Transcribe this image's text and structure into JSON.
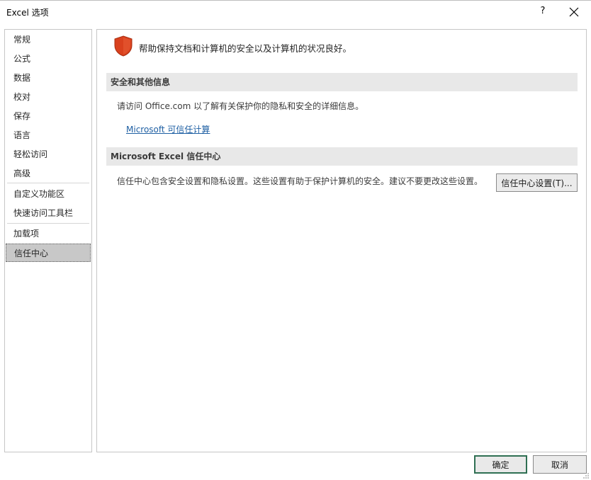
{
  "window": {
    "title": "Excel 选项",
    "help_label": "?"
  },
  "sidebar": {
    "items": [
      {
        "label": "常规"
      },
      {
        "label": "公式"
      },
      {
        "label": "数据"
      },
      {
        "label": "校对"
      },
      {
        "label": "保存"
      },
      {
        "label": "语言"
      },
      {
        "label": "轻松访问"
      },
      {
        "label": "高级"
      },
      {
        "label": "自定义功能区"
      },
      {
        "label": "快速访问工具栏"
      },
      {
        "label": "加载项"
      },
      {
        "label": "信任中心"
      }
    ],
    "selected": "信任中心"
  },
  "main": {
    "header": "帮助保持文档和计算机的安全以及计算机的状况良好。",
    "section_security": {
      "title": "安全和其他信息",
      "text": "请访问 Office.com 以了解有关保护你的隐私和安全的详细信息。",
      "link": "Microsoft 可信任计算"
    },
    "section_trust": {
      "title": "Microsoft Excel 信任中心",
      "text": "信任中心包含安全设置和隐私设置。这些设置有助于保护计算机的安全。建议不要更改这些设置。",
      "button": "信任中心设置(T)..."
    }
  },
  "footer": {
    "ok_label": "确定",
    "cancel_label": "取消"
  },
  "colors": {
    "shield": "#d9411e",
    "link": "#1e5fa3",
    "selected_item": "#c8c8c8",
    "section_header": "#e8e8e8",
    "primary_button_border": "#2f6f53"
  }
}
